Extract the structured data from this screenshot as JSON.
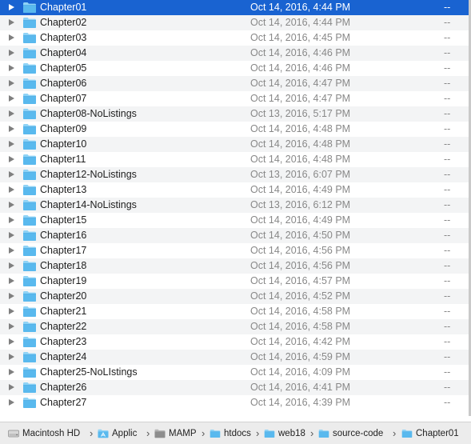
{
  "files": [
    {
      "name": "Chapter01",
      "date": "Oct 14, 2016, 4:44 PM",
      "size": "--",
      "selected": true
    },
    {
      "name": "Chapter02",
      "date": "Oct 14, 2016, 4:44 PM",
      "size": "--"
    },
    {
      "name": "Chapter03",
      "date": "Oct 14, 2016, 4:45 PM",
      "size": "--"
    },
    {
      "name": "Chapter04",
      "date": "Oct 14, 2016, 4:46 PM",
      "size": "--"
    },
    {
      "name": "Chapter05",
      "date": "Oct 14, 2016, 4:46 PM",
      "size": "--"
    },
    {
      "name": "Chapter06",
      "date": "Oct 14, 2016, 4:47 PM",
      "size": "--"
    },
    {
      "name": "Chapter07",
      "date": "Oct 14, 2016, 4:47 PM",
      "size": "--"
    },
    {
      "name": "Chapter08-NoListings",
      "date": "Oct 13, 2016, 5:17 PM",
      "size": "--"
    },
    {
      "name": "Chapter09",
      "date": "Oct 14, 2016, 4:48 PM",
      "size": "--"
    },
    {
      "name": "Chapter10",
      "date": "Oct 14, 2016, 4:48 PM",
      "size": "--"
    },
    {
      "name": "Chapter11",
      "date": "Oct 14, 2016, 4:48 PM",
      "size": "--"
    },
    {
      "name": "Chapter12-NoListings",
      "date": "Oct 13, 2016, 6:07 PM",
      "size": "--"
    },
    {
      "name": "Chapter13",
      "date": "Oct 14, 2016, 4:49 PM",
      "size": "--"
    },
    {
      "name": "Chapter14-NoListings",
      "date": "Oct 13, 2016, 6:12 PM",
      "size": "--"
    },
    {
      "name": "Chapter15",
      "date": "Oct 14, 2016, 4:49 PM",
      "size": "--"
    },
    {
      "name": "Chapter16",
      "date": "Oct 14, 2016, 4:50 PM",
      "size": "--"
    },
    {
      "name": "Chapter17",
      "date": "Oct 14, 2016, 4:56 PM",
      "size": "--"
    },
    {
      "name": "Chapter18",
      "date": "Oct 14, 2016, 4:56 PM",
      "size": "--"
    },
    {
      "name": "Chapter19",
      "date": "Oct 14, 2016, 4:57 PM",
      "size": "--"
    },
    {
      "name": "Chapter20",
      "date": "Oct 14, 2016, 4:52 PM",
      "size": "--"
    },
    {
      "name": "Chapter21",
      "date": "Oct 14, 2016, 4:58 PM",
      "size": "--"
    },
    {
      "name": "Chapter22",
      "date": "Oct 14, 2016, 4:58 PM",
      "size": "--"
    },
    {
      "name": "Chapter23",
      "date": "Oct 14, 2016, 4:42 PM",
      "size": "--"
    },
    {
      "name": "Chapter24",
      "date": "Oct 14, 2016, 4:59 PM",
      "size": "--"
    },
    {
      "name": "Chapter25-NoLIstings",
      "date": "Oct 14, 2016, 4:09 PM",
      "size": "--"
    },
    {
      "name": "Chapter26",
      "date": "Oct 14, 2016, 4:41 PM",
      "size": "--"
    },
    {
      "name": "Chapter27",
      "date": "Oct 14, 2016, 4:39 PM",
      "size": "--"
    }
  ],
  "path_bar": [
    {
      "label": "Macintosh HD",
      "icon": "hard-drive-icon"
    },
    {
      "label": "Applic",
      "icon": "applications-folder-icon"
    },
    {
      "label": "MAMP",
      "icon": "app-folder-icon"
    },
    {
      "label": "htdocs",
      "icon": "folder-icon"
    },
    {
      "label": "web18",
      "icon": "folder-icon"
    },
    {
      "label": "source-code",
      "icon": "folder-icon"
    },
    {
      "label": "Chapter01",
      "icon": "folder-icon"
    }
  ],
  "path_separator": "›",
  "colors": {
    "selection": "#1963d1",
    "alt_row": "#f3f4f5",
    "folder_body": "#59b9ee",
    "folder_tab": "#8fd3f6",
    "secondary_text": "#888888"
  }
}
